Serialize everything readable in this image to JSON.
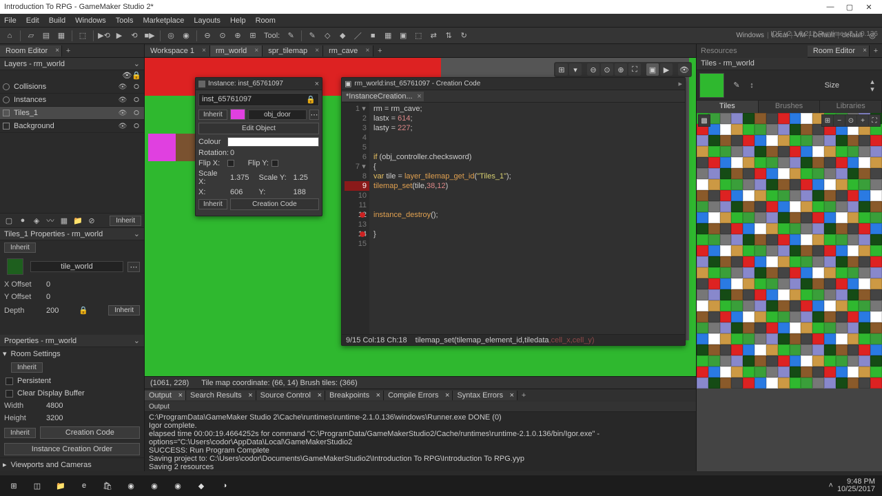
{
  "titlebar": {
    "title": "Introduction To RPG - GameMaker Studio 2*"
  },
  "menubar": [
    "File",
    "Edit",
    "Build",
    "Windows",
    "Tools",
    "Marketplace",
    "Layouts",
    "Help",
    "Room"
  ],
  "toolbar_right": {
    "targets": [
      "Windows",
      "Local",
      "VM",
      "Default",
      "default"
    ],
    "ide": "IDE v2.1.0.212 Runtime v2.1.0.136"
  },
  "toolbar_center_label": "Tool:",
  "left": {
    "room_editor_tab": "Room Editor",
    "layers_hdr": "Layers - rm_world",
    "layers": [
      {
        "name": "Collisions",
        "type": "dot"
      },
      {
        "name": "Instances",
        "type": "dot"
      },
      {
        "name": "Tiles_1",
        "type": "tile",
        "sel": true
      },
      {
        "name": "Background",
        "type": "bg"
      }
    ],
    "inherit": "Inherit",
    "tiles1_props_hdr": "Tiles_1 Properties - rm_world",
    "tileset_name": "tile_world",
    "xoffset_lbl": "X Offset",
    "xoffset": "0",
    "yoffset_lbl": "Y Offset",
    "yoffset": "0",
    "depth_lbl": "Depth",
    "depth": "200",
    "props_hdr": "Properties - rm_world",
    "room_settings": "Room Settings",
    "persistent": "Persistent",
    "clear_buf": "Clear Display Buffer",
    "width_lbl": "Width",
    "width": "4800",
    "height_lbl": "Height",
    "height": "3200",
    "creation_code": "Creation Code",
    "inst_order": "Instance Creation Order",
    "viewports": "Viewports and Cameras"
  },
  "center": {
    "tabs": [
      {
        "label": "Workspace 1",
        "active": false
      },
      {
        "label": "rm_world",
        "active": true
      },
      {
        "label": "spr_tilemap",
        "active": false
      },
      {
        "label": "rm_cave",
        "active": false
      }
    ],
    "status_coord": "(1061, 228)",
    "status_tilemap": "Tile map coordinate: (66, 14) Brush tiles: (366)"
  },
  "instance_panel": {
    "title": "Instance: inst_65761097",
    "name": "inst_65761097",
    "inherit": "Inherit",
    "object": "obj_door",
    "edit_object": "Edit Object",
    "colour_lbl": "Colour",
    "rotation_lbl": "Rotation:",
    "rotation": "0",
    "flipx_lbl": "Flip X:",
    "flipy_lbl": "Flip Y:",
    "scalex_lbl": "Scale X:",
    "scalex": "1.375",
    "scaley_lbl": "Scale Y:",
    "scaley": "1.25",
    "x_lbl": "X:",
    "x": "606",
    "y_lbl": "Y:",
    "y": "188",
    "creation_code": "Creation Code"
  },
  "code_panel": {
    "title": "rm_world:inst_65761097 - Creation Code",
    "tab": "*InstanceCreation...",
    "lines": [
      "rm = rm_cave;",
      "lastx = 614;",
      "lasty = 227;",
      "",
      "",
      "if (obj_controller.checksword)",
      "{",
      "var tile = layer_tilemap_get_id(\"Tiles_1\");",
      "tilemap_set(tile,38,12)",
      "",
      "",
      "instance_destroy();",
      "",
      "}",
      ""
    ],
    "status_pos": "9/15 Col:18 Ch:18",
    "status_help": "tilemap_set(tilemap_element_id,tiledata",
    "status_hint": ",cell_x,cell_y)"
  },
  "right": {
    "resources": "Resources",
    "room_editor_tab": "Room Editor",
    "tiles_hdr": "Tiles - rm_world",
    "size": "Size",
    "tabs": [
      "Tiles",
      "Brushes",
      "Libraries"
    ]
  },
  "output": {
    "tabs": [
      "Output",
      "Search Results",
      "Source Control",
      "Breakpoints",
      "Compile Errors",
      "Syntax Errors"
    ],
    "hdr": "Output",
    "lines": [
      "C:\\ProgramData\\GameMaker Studio 2\\Cache\\runtimes\\runtime-2.1.0.136\\windows\\Runner.exe DONE (0)",
      "Igor complete.",
      "elapsed time 00:00:19.4664252s for command \"C:\\ProgramData/GameMakerStudio2/Cache/runtimes\\runtime-2.1.0.136/bin/Igor.exe\" -options=\"C:\\Users\\codor\\AppData\\Local\\GameMakerStudio2",
      "SUCCESS: Run Program Complete",
      "Saving project to: C:\\Users\\codor\\Documents\\GameMakerStudio2\\Introduction To RPG\\Introduction To RPG.yyp",
      "Saving 2 resources"
    ]
  },
  "taskbar": {
    "time": "9:48 PM",
    "date": "10/25/2017"
  }
}
